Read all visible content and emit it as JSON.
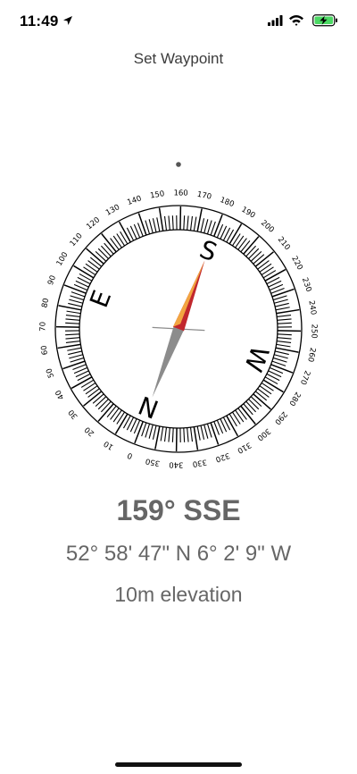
{
  "status_bar": {
    "time": "11:49",
    "icons": [
      "location-arrow-icon",
      "signal-icon",
      "wifi-icon",
      "battery-charging-icon"
    ]
  },
  "header": {
    "title": "Set Waypoint"
  },
  "compass": {
    "heading_degrees": 159,
    "tick_labels": [
      "0",
      "10",
      "20",
      "30",
      "40",
      "50",
      "60",
      "70",
      "80",
      "90",
      "100",
      "110",
      "120",
      "130",
      "140",
      "150",
      "160",
      "170",
      "180",
      "190",
      "200",
      "210",
      "220",
      "230",
      "240",
      "250",
      "260",
      "270",
      "280",
      "290",
      "300",
      "310",
      "320",
      "330",
      "340",
      "350"
    ],
    "cardinals": [
      "N",
      "E",
      "S",
      "W"
    ],
    "needle_colors": {
      "north": "#c1272d",
      "north_edge": "#f2a541",
      "south": "#8c8c8c"
    }
  },
  "readout": {
    "heading": "159° SSE",
    "coordinates": "52° 58' 47\" N 6° 2' 9\" W",
    "elevation": "10m elevation"
  }
}
